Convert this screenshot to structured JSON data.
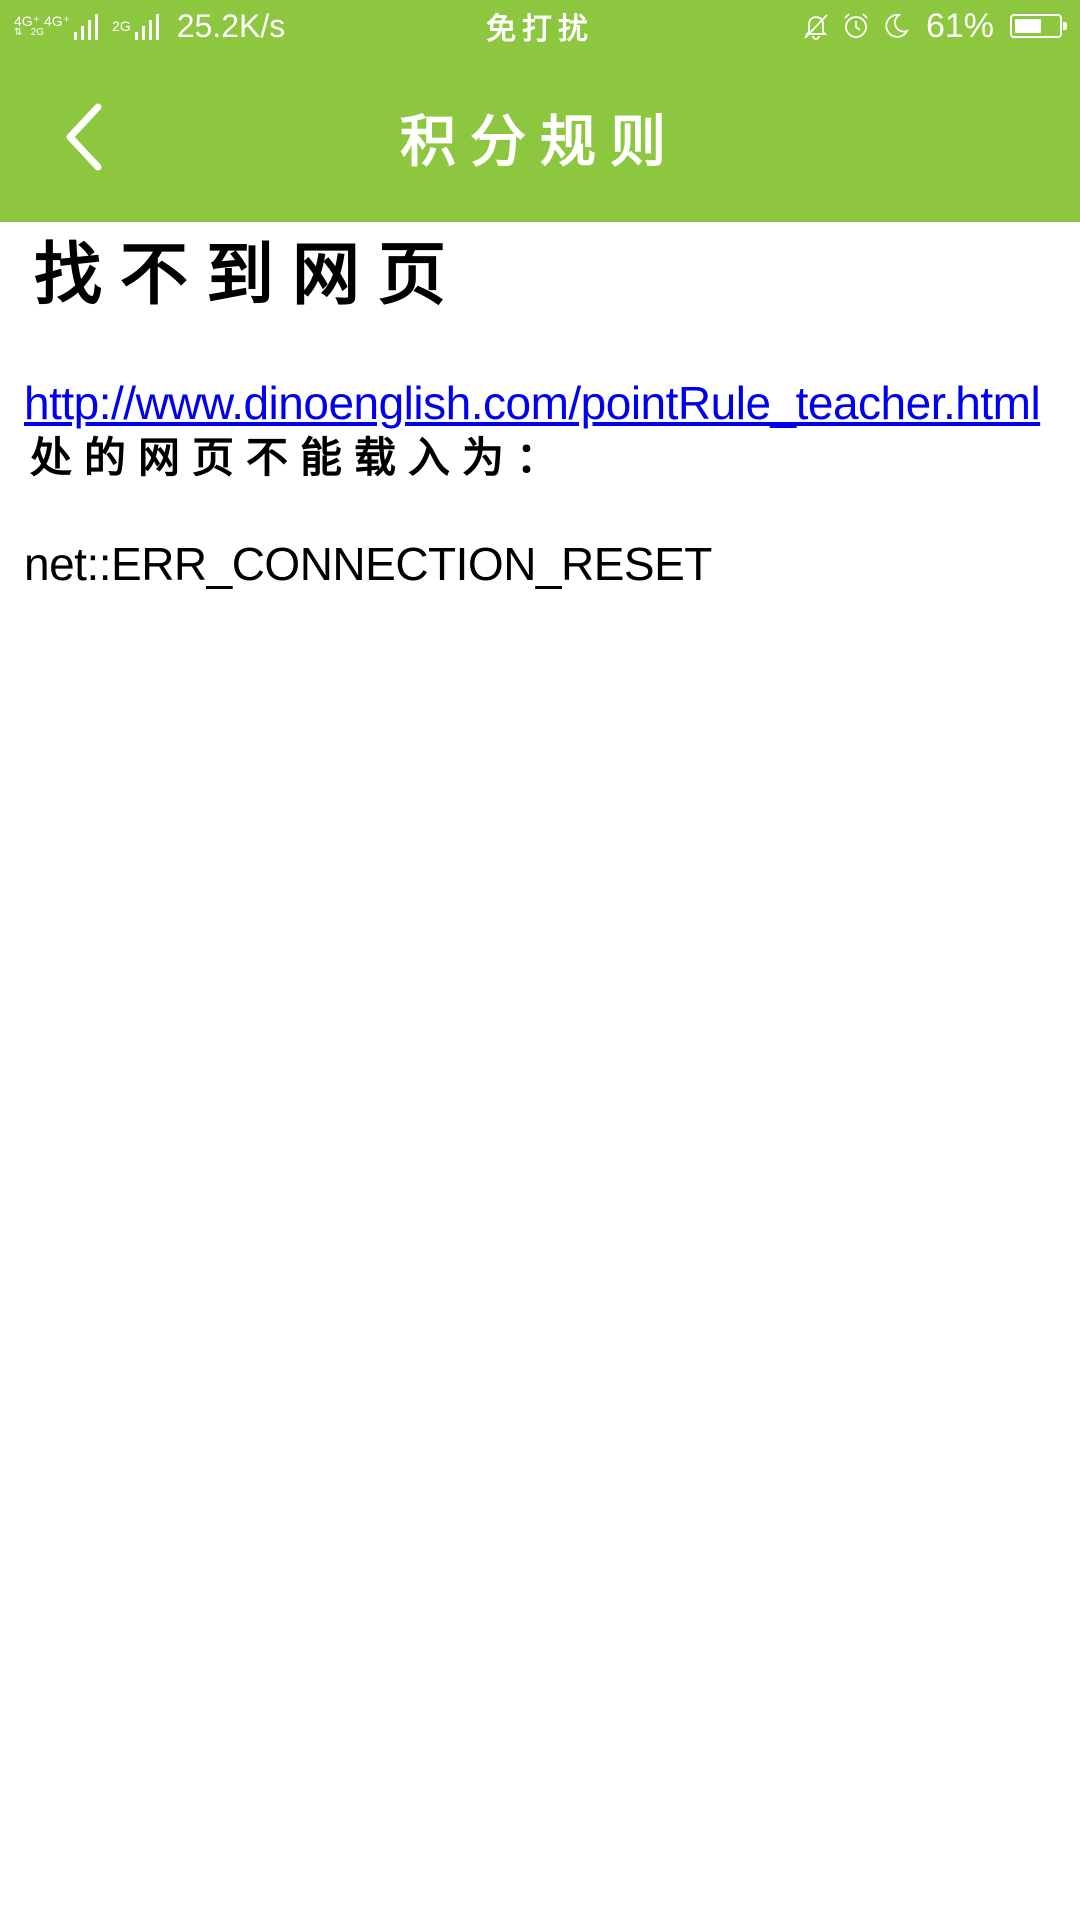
{
  "status_bar": {
    "network_label_top": "4G⁺ 4G⁺",
    "network_label_bottom": "2G",
    "network_label_2g": "2G",
    "speed": "25.2K/s",
    "mode": "免打扰",
    "battery_percent": "61%",
    "battery_level": 0.61,
    "icons": [
      "bell-muted-icon",
      "alarm-icon",
      "moon-icon",
      "battery-icon"
    ]
  },
  "header": {
    "title": "积分规则",
    "back_icon": "chevron-left-icon",
    "background_color": "#8dc63f"
  },
  "error_page": {
    "title": "找不到网页",
    "url": "http://www.dinoenglish.com/pointRule_teacher.html",
    "description": "处的网页不能载入为：",
    "error_code": "net::ERR_CONNECTION_RESET",
    "link_color": "#0000ee"
  }
}
